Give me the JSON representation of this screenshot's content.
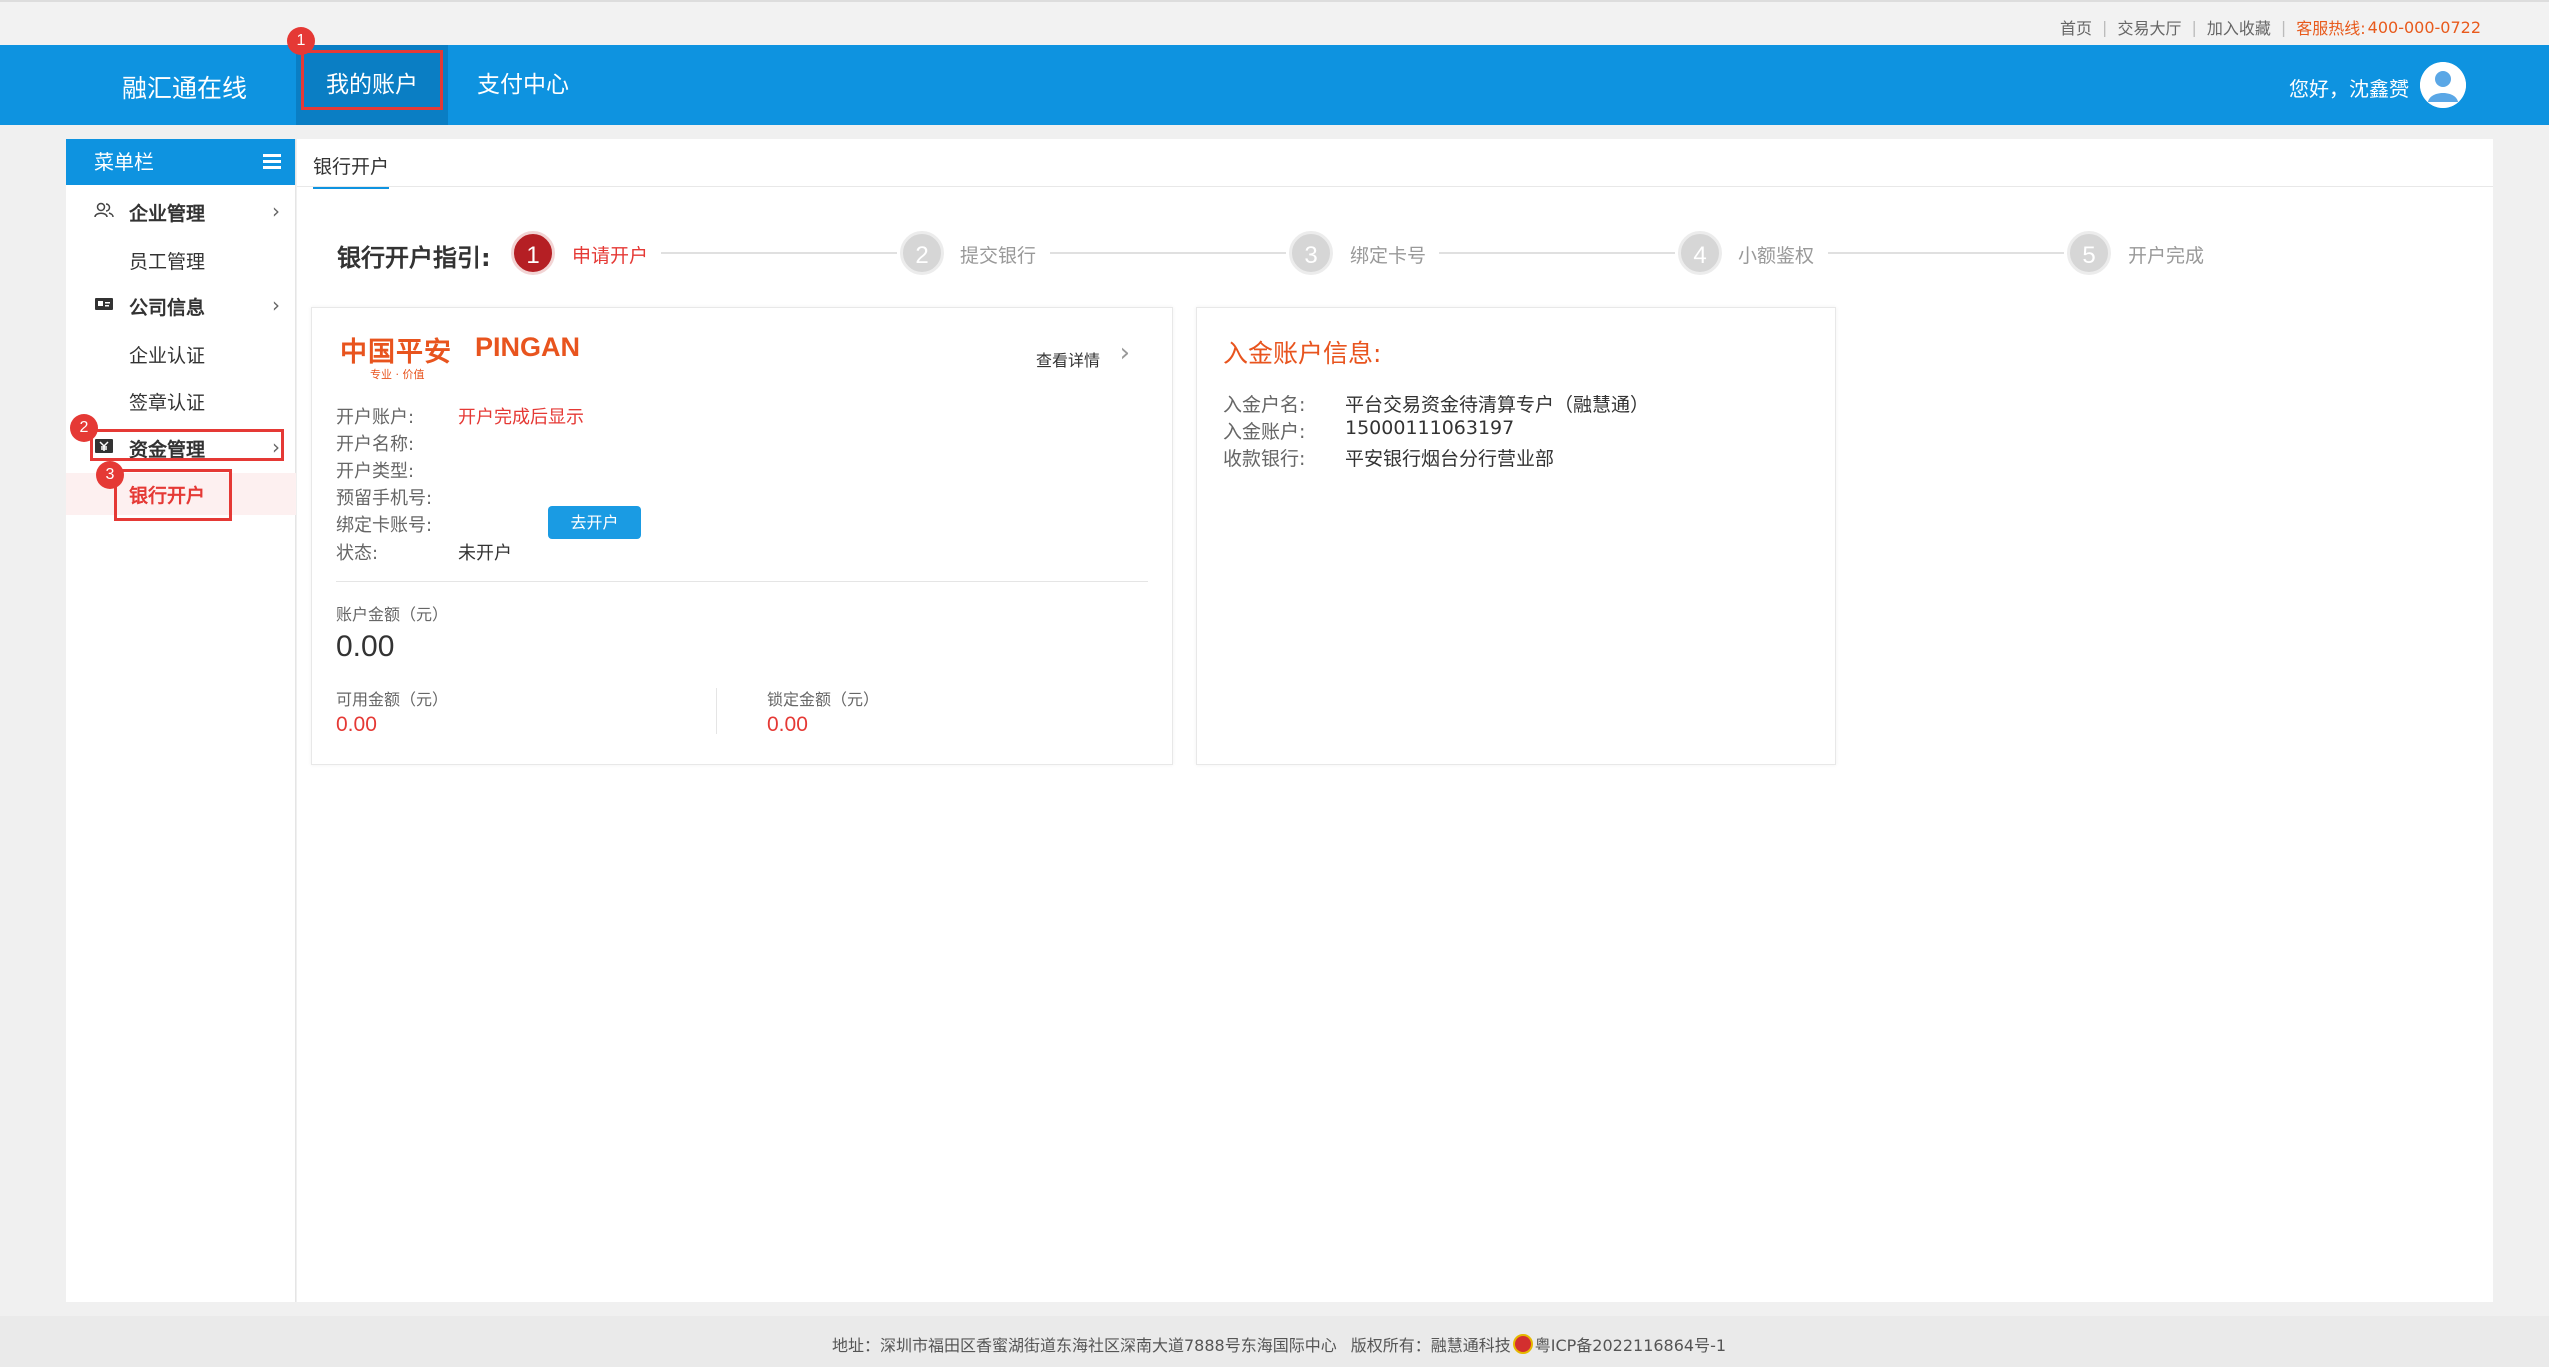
{
  "toplinks": {
    "home": "首页",
    "trade_hall": "交易大厅",
    "favorite": "加入收藏",
    "hotline_label": "客服热线:",
    "hotline_number": "400-000-0722"
  },
  "navbar": {
    "brand": "融汇通在线",
    "tabs": [
      "我的账户",
      "支付中心"
    ],
    "greeting": "您好，沈鑫赟",
    "accent_color": "#0e93e0"
  },
  "annotations": [
    "1",
    "2",
    "3"
  ],
  "sidebar": {
    "title": "菜单栏",
    "groups": [
      {
        "label": "企业管理",
        "icon": "users-icon",
        "items": [
          "员工管理"
        ]
      },
      {
        "label": "公司信息",
        "icon": "id-card-icon",
        "items": [
          "企业认证",
          "签章认证"
        ]
      },
      {
        "label": "资金管理",
        "icon": "yen-icon",
        "items": [
          "银行开户"
        ]
      }
    ]
  },
  "main": {
    "tab": "银行开户",
    "guide_title": "银行开户指引:",
    "steps": [
      {
        "num": "1",
        "label": "申请开户"
      },
      {
        "num": "2",
        "label": "提交银行"
      },
      {
        "num": "3",
        "label": "绑定卡号"
      },
      {
        "num": "4",
        "label": "小额鉴权"
      },
      {
        "num": "5",
        "label": "开户完成"
      }
    ]
  },
  "bank_card": {
    "logo_cn": "中国平安",
    "logo_en": "PINGAN",
    "logo_tagline": "专业 · 价值",
    "detail_link": "查看详情",
    "fields": [
      {
        "label": "开户账户:",
        "value": "开户完成后显示"
      },
      {
        "label": "开户名称:",
        "value": ""
      },
      {
        "label": "开户类型:",
        "value": ""
      },
      {
        "label": "预留手机号:",
        "value": ""
      },
      {
        "label": "绑定卡账号:",
        "value": ""
      },
      {
        "label": "状态:",
        "value": "未开户"
      }
    ],
    "open_button": "去开户",
    "balance_label": "账户金额（元）",
    "balance": "0.00",
    "available_label": "可用金额（元）",
    "available": "0.00",
    "locked_label": "锁定金额（元）",
    "locked": "0.00"
  },
  "deposit_info": {
    "title": "入金账户信息:",
    "rows": [
      {
        "label": "入金户名:",
        "value": "平台交易资金待清算专户（融慧通）"
      },
      {
        "label": "入金账户:",
        "value": "15000111063197"
      },
      {
        "label": "收款银行:",
        "value": "平安银行烟台分行营业部"
      }
    ]
  },
  "footer": {
    "address": "地址：深圳市福田区香蜜湖街道东海社区深南大道7888号东海国际中心",
    "copyright": "版权所有：融慧通科技",
    "icp": "粤ICP备2022116864号-1"
  }
}
